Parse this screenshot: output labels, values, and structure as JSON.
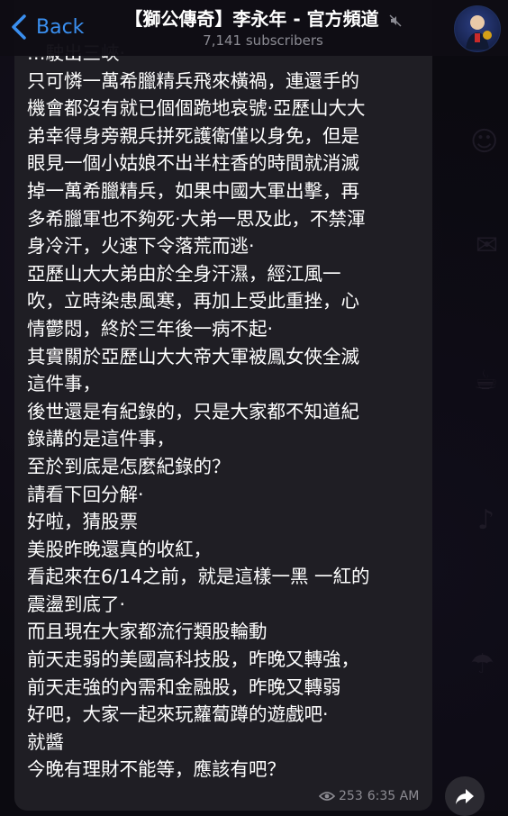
{
  "header": {
    "back_label": "Back",
    "channel_title": "【獅公傳奇】李永年 - 官方頻道",
    "subscribers": "7,141 subscribers"
  },
  "message": {
    "lines": [
      "…駛出三峽·",
      "只可憐一萬希臘精兵飛來橫禍，連還手的",
      "機會都沒有就已個個跪地哀號·亞歷山大大",
      "弟幸得身旁親兵拼死護衛僅以身免，但是",
      "眼見一個小姑娘不出半柱香的時間就消滅",
      "掉一萬希臘精兵，如果中國大軍出擊，再",
      "多希臘軍也不夠死·大弟一思及此，不禁渾",
      "身冷汗，火速下令落荒而逃·",
      "亞歷山大大弟由於全身汗濕，經江風一",
      "吹，立時染患風寒，再加上受此重挫，心",
      "情鬱悶，終於三年後一病不起·",
      "其實關於亞歷山大大帝大軍被鳳女俠全滅",
      "這件事，",
      "後世還是有紀錄的，只是大家都不知道紀",
      "錄講的是這件事，",
      "至於到底是怎麼紀錄的？",
      "請看下回分解·",
      "好啦，猜股票",
      "美股昨晚還真的收紅，",
      "看起來在6/14之前，就是這樣一黑 一紅的",
      "震盪到底了·",
      "而且現在大家都流行類股輪動",
      "前天走弱的美國高科技股，昨晚又轉強，",
      "前天走強的內需和金融股，昨晚又轉弱",
      "好吧，大家一起來玩蘿蔔蹲的遊戲吧·",
      "就醬",
      "今晚有理財不能等，應該有吧？"
    ],
    "views": "253",
    "time": "6:35 AM"
  },
  "colors": {
    "accent": "#3a8ff0",
    "bubble": "#1f1e24",
    "background": "#0b0a10"
  }
}
